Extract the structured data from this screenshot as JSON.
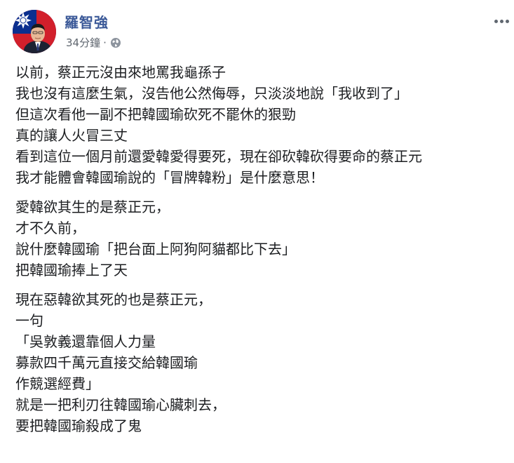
{
  "post": {
    "author": "羅智強",
    "timestamp": "34分鐘",
    "separator": "·",
    "privacy_icon": "globe-icon",
    "more_icon": "more-options-icon",
    "paragraphs": [
      {
        "lines": [
          "以前，蔡正元沒由來地罵我龜孫子",
          "我也沒有這麼生氣，沒告他公然侮辱，只淡淡地說「我收到了」",
          "但這次看他一副不把韓國瑜砍死不罷休的狠勁",
          "真的讓人火冒三丈",
          "看到這位一個月前還愛韓愛得要死，現在卻砍韓砍得要命的蔡正元",
          "我才能體會韓國瑜說的「冒牌韓粉」是什麼意思！"
        ]
      },
      {
        "lines": [
          "愛韓欲其生的是蔡正元，",
          "才不久前，",
          "說什麼韓國瑜「把台面上阿狗阿貓都比下去」",
          "把韓國瑜捧上了天"
        ]
      },
      {
        "lines": [
          "現在惡韓欲其死的也是蔡正元，",
          "一句",
          "「吳敦義還靠個人力量",
          "募款四千萬元直接交給韓國瑜",
          "作競選經費」",
          "就是一把利刃往韓國瑜心臟刺去，",
          "要把韓國瑜殺成了鬼"
        ]
      }
    ]
  },
  "colors": {
    "name_link": "#3b5998",
    "meta_text": "#606770",
    "body_text": "#1c1e21",
    "flag_blue": "#0b2f8f",
    "flag_red": "#d21f2b"
  }
}
